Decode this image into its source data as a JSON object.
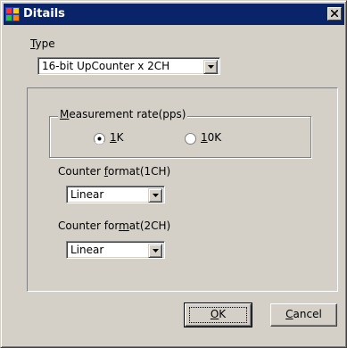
{
  "window": {
    "title": "Ditails",
    "close_symbol": "×"
  },
  "type": {
    "label_access": "T",
    "label_rest": "ype",
    "value": "16-bit UpCounter x 2CH"
  },
  "measurement": {
    "label_access": "M",
    "label_rest": "easurement rate(pps)",
    "options": [
      {
        "access": "1",
        "rest": "K",
        "selected": true
      },
      {
        "access": "1",
        "rest": "0K",
        "selected": false
      }
    ]
  },
  "counter1": {
    "label_pre": "Counter ",
    "label_access": "f",
    "label_rest": "ormat(1CH)",
    "value": "Linear"
  },
  "counter2": {
    "label_pre": "Counter for",
    "label_access": "m",
    "label_rest": "at(2CH)",
    "value": "Linear"
  },
  "buttons": {
    "ok_access": "O",
    "ok_rest": "K",
    "cancel_access": "C",
    "cancel_rest": "ancel"
  }
}
